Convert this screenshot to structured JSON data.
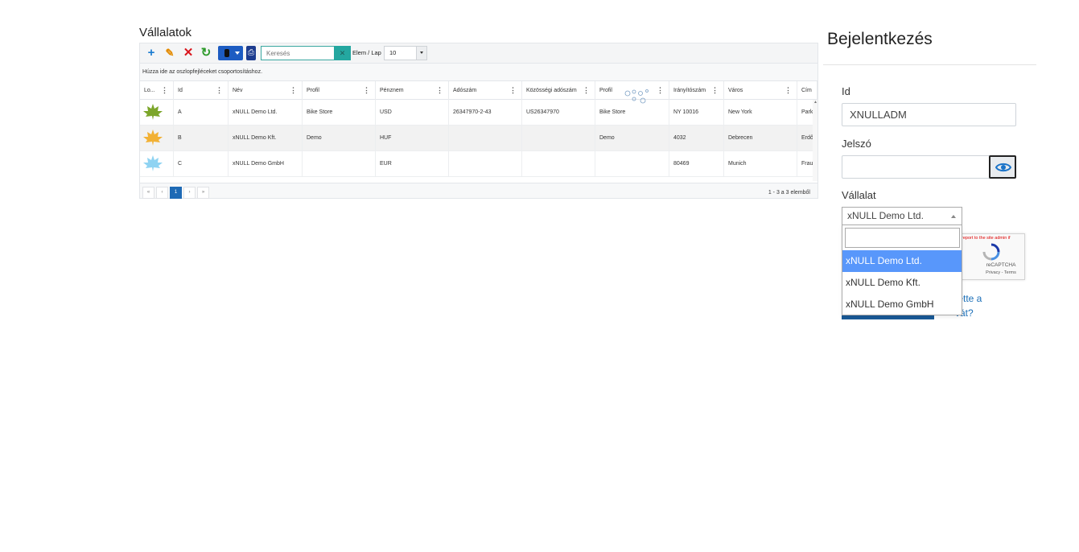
{
  "grid": {
    "title": "Vállalatok",
    "toolbar": {
      "add_icon": "+",
      "edit_icon": "✎",
      "delete_icon": "✕",
      "refresh_icon": "↻",
      "export_button": "export-dropdown",
      "attachment_button": "attachment",
      "search_placeholder": "Keresés",
      "search_clear_icon": "✕",
      "per_page_label": "Elem / Lap",
      "per_page_value": "10"
    },
    "group_hint": "Húzza ide az oszlopfejléceket csoportosításhoz.",
    "columns": [
      "Lo...",
      "Id",
      "Név",
      "Profil",
      "Pénznem",
      "Adószám",
      "Közösségi adószám",
      "Profil",
      "Irányítószám",
      "Város",
      "Cím"
    ],
    "rows": [
      {
        "logo_color": "#7ca62a",
        "id": "A",
        "name": "xNULL Demo Ltd.",
        "profile": "Bike Store",
        "currency": "USD",
        "tax": "26347970-2-43",
        "eu_tax": "US26347970",
        "profile2": "Bike Store",
        "zip": "NY 10016",
        "city": "New York",
        "address": "Park"
      },
      {
        "logo_color": "#f2b134",
        "id": "B",
        "name": "xNULL Demo Kft.",
        "profile": "Demo",
        "currency": "HUF",
        "tax": "",
        "eu_tax": "",
        "profile2": "Demo",
        "zip": "4032",
        "city": "Debrecen",
        "address": "Erdő"
      },
      {
        "logo_color": "#8fd3f2",
        "id": "C",
        "name": "xNULL Demo GmbH",
        "profile": "",
        "currency": "EUR",
        "tax": "",
        "eu_tax": "",
        "profile2": "",
        "zip": "80469",
        "city": "Munich",
        "address": "Frau"
      }
    ],
    "pager": {
      "first": "«",
      "prev": "‹",
      "current": "1",
      "next": "›",
      "last": "»",
      "info": "1 - 3 a 3 elemből"
    }
  },
  "login": {
    "title": "Bejelentkezés",
    "id_label": "Id",
    "id_value": "XNULLADM",
    "password_label": "Jelszó",
    "password_value": "",
    "company_label": "Vállalat",
    "company_selected": "xNULL Demo Ltd.",
    "company_options": [
      "xNULL Demo Ltd.",
      "xNULL Demo Kft.",
      "xNULL Demo GmbH"
    ],
    "company_search_value": "",
    "forgot_line1": "tette a",
    "forgot_line2": "vát?",
    "recaptcha_error": "report to the site admin if",
    "recaptcha_brand": "reCAPTCHA",
    "recaptcha_terms": "Privacy - Terms"
  },
  "colors": {
    "primary": "#1e6ab5",
    "accent_teal": "#24a7a0",
    "selection": "#5897fb",
    "link": "#1b6fb8"
  }
}
